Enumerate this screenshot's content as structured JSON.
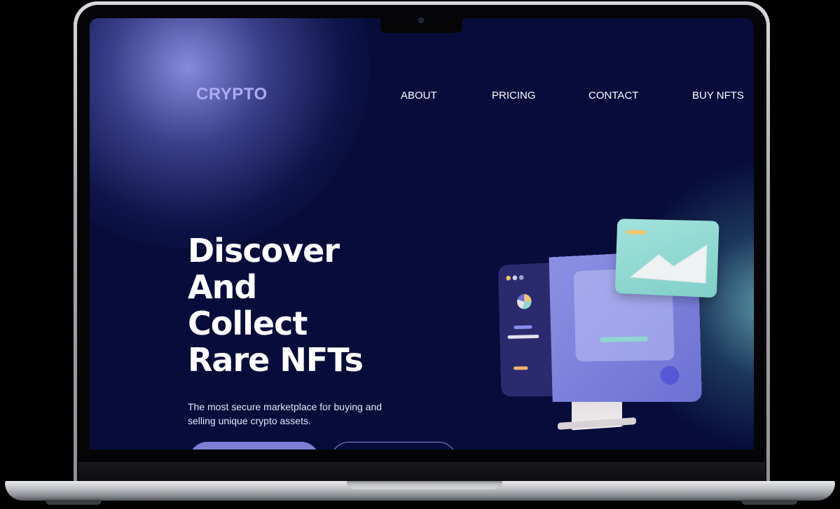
{
  "site": {
    "brand": "CRYPTO",
    "nav": [
      "ABOUT",
      "PRICING",
      "CONTACT",
      "BUY NFTS"
    ]
  },
  "hero": {
    "headline_lines": [
      "Discover",
      "And",
      "Collect",
      "Rare NFTs"
    ],
    "subtext": "The most secure marketplace for buying and selling unique crypto assets."
  },
  "colors": {
    "background": "#070c3b",
    "brand": "#a9acee",
    "accent": "#7a7fd4",
    "teal": "#8fd6cf"
  },
  "illustration": {
    "icon": "computer-monitor-nft-illustration"
  }
}
